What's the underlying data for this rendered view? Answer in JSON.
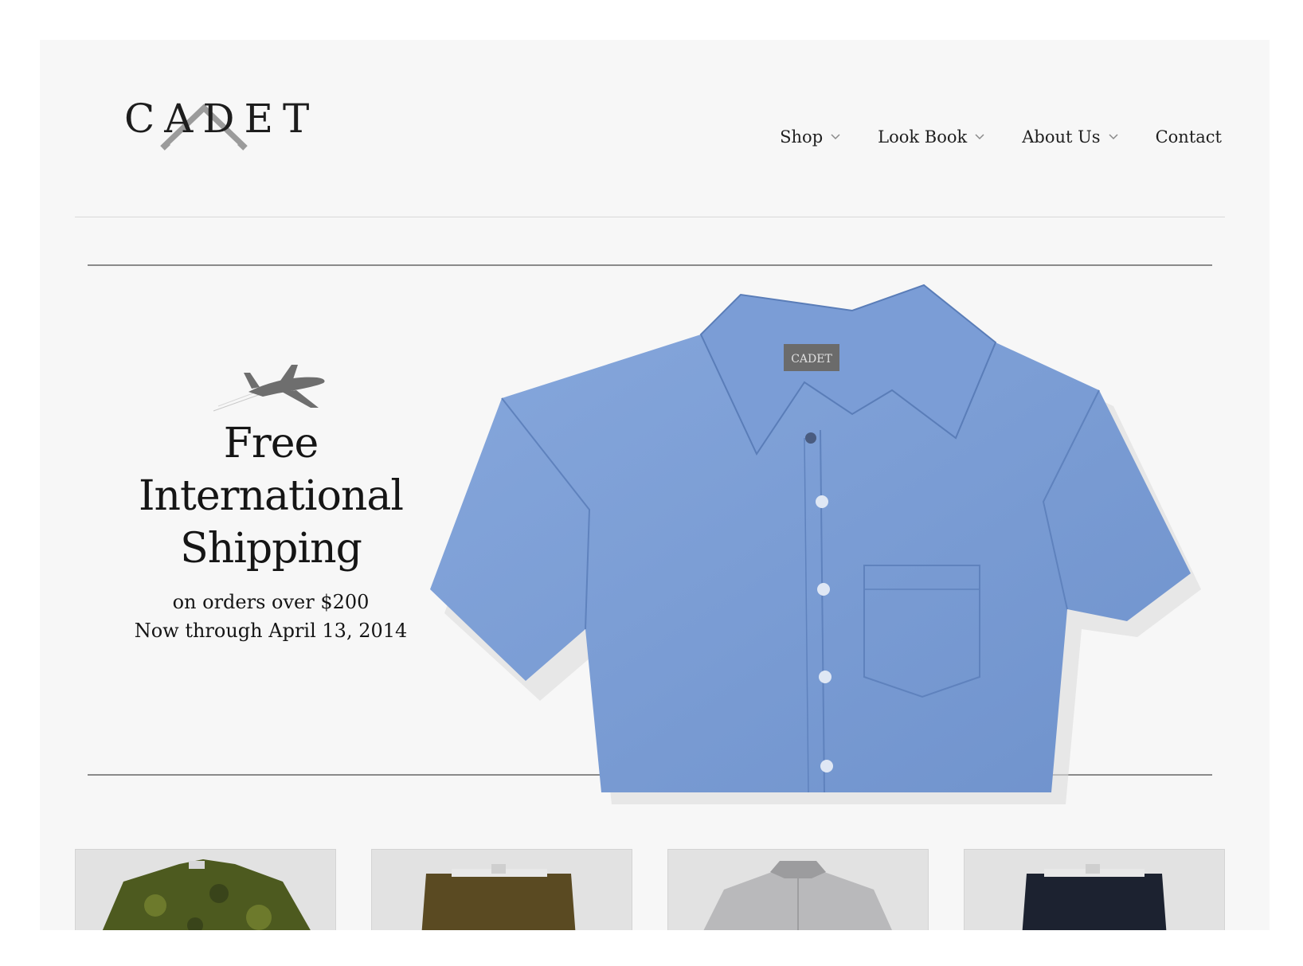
{
  "brand": {
    "logo_text": "CADET"
  },
  "nav": {
    "items": [
      {
        "label": "Shop",
        "has_dropdown": true
      },
      {
        "label": "Look Book",
        "has_dropdown": true
      },
      {
        "label": "About Us",
        "has_dropdown": true
      },
      {
        "label": "Contact",
        "has_dropdown": false
      }
    ]
  },
  "hero": {
    "headline_line1": "Free",
    "headline_line2": "International",
    "headline_line3": "Shipping",
    "sub_line1": "on orders over $200",
    "sub_line2": "Now through April 13, 2014",
    "shirt_label": "CADET",
    "shirt_color": "#7d9fd6"
  },
  "products": [
    {
      "name": "camo-shirt",
      "color": "#4d5a1f"
    },
    {
      "name": "olive-pants",
      "color": "#5a4a22"
    },
    {
      "name": "grey-henley",
      "color": "#b9b9bb"
    },
    {
      "name": "navy-pants",
      "color": "#1c2230"
    }
  ],
  "colors": {
    "background": "#f7f7f7",
    "text": "#1d1d1d",
    "rule": "#8a8a8a"
  }
}
